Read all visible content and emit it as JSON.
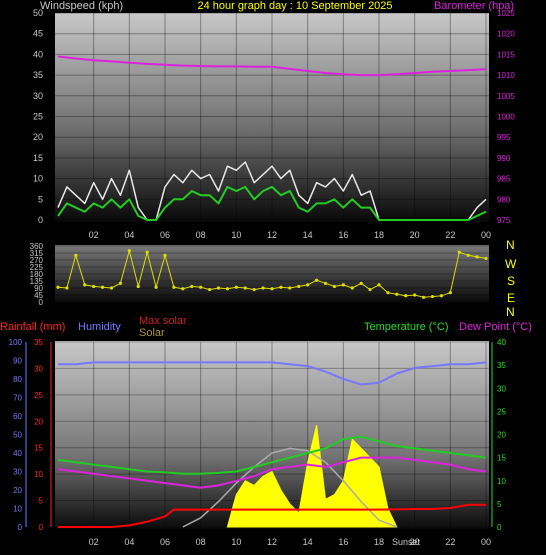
{
  "header": {
    "windspeed_label": "Windspeed (kph)",
    "title": "24 hour graph day : 10 September 2025",
    "barometer_label": "Barometer (hpa)"
  },
  "legend": {
    "rainfall": "Rainfall (mm)",
    "humidity": "Humidity",
    "max_solar": "Max solar",
    "solar": "Solar",
    "temperature": "Temperature (°C)",
    "dew_point": "Dew Point (°C)"
  },
  "annotations": {
    "sunset": "Sunset"
  },
  "colors": {
    "wind_gust": "#e8e8e8",
    "wind_avg": "#22cc22",
    "barometer": "#dd22dd",
    "direction": "#dddd00",
    "rain": "#ff0000",
    "humidity": "#7777ff",
    "temperature": "#22cc22",
    "dew_point": "#dd22dd",
    "solar": "#ffff00",
    "max_solar": "#aaaaaa"
  },
  "chart_data": [
    {
      "type": "line",
      "title": "24 hour graph day : 10 September 2025",
      "xlabel": "",
      "x_ticks": [
        "02",
        "04",
        "06",
        "08",
        "10",
        "12",
        "14",
        "16",
        "18",
        "20",
        "22",
        "00"
      ],
      "left_axis": {
        "label": "Windspeed (kph)",
        "ylim": [
          0,
          50
        ],
        "ticks": [
          0,
          5,
          10,
          15,
          20,
          25,
          30,
          35,
          40,
          45,
          50
        ]
      },
      "right_axis": {
        "label": "Barometer (hpa)",
        "ylim": [
          975,
          1025
        ],
        "ticks": [
          975,
          980,
          985,
          990,
          995,
          1000,
          1005,
          1010,
          1015,
          1020,
          1025
        ]
      },
      "series": [
        {
          "name": "Barometer (hpa)",
          "axis": "right",
          "x": [
            0,
            1,
            2,
            3,
            4,
            5,
            6,
            7,
            8,
            9,
            10,
            11,
            12,
            13,
            14,
            15,
            16,
            17,
            18,
            19,
            20,
            21,
            22,
            23,
            24
          ],
          "values": [
            1014.5,
            1014.0,
            1013.6,
            1013.3,
            1013.0,
            1012.7,
            1012.5,
            1012.3,
            1012.2,
            1012.1,
            1012.1,
            1012.0,
            1012.0,
            1011.5,
            1011.0,
            1010.5,
            1010.2,
            1010.0,
            1010.0,
            1010.2,
            1010.5,
            1010.8,
            1011.0,
            1011.2,
            1011.4
          ]
        },
        {
          "name": "Windspeed (kph)",
          "axis": "left",
          "x": [
            0,
            0.5,
            1,
            1.5,
            2,
            2.5,
            3,
            3.5,
            4,
            4.5,
            5,
            5.5,
            6,
            6.5,
            7,
            7.5,
            8,
            8.5,
            9,
            9.5,
            10,
            10.5,
            11,
            11.5,
            12,
            12.5,
            13,
            13.5,
            14,
            14.5,
            15,
            15.5,
            16,
            16.5,
            17,
            17.5,
            18,
            18.5,
            19,
            20,
            21,
            22,
            23,
            23.5,
            24
          ],
          "values": [
            3,
            8,
            6,
            4,
            9,
            5,
            10,
            6,
            12,
            3,
            0,
            0,
            8,
            11,
            9,
            12,
            10,
            11,
            7,
            13,
            12,
            14,
            9,
            11,
            13,
            10,
            12,
            6,
            4,
            9,
            8,
            10,
            7,
            11,
            6,
            7,
            0,
            0,
            0,
            0,
            0,
            0,
            0,
            3,
            5
          ]
        },
        {
          "name": "Average windspeed",
          "axis": "left",
          "x": [
            0,
            0.5,
            1,
            1.5,
            2,
            2.5,
            3,
            3.5,
            4,
            4.5,
            5,
            5.5,
            6,
            6.5,
            7,
            7.5,
            8,
            8.5,
            9,
            9.5,
            10,
            10.5,
            11,
            11.5,
            12,
            12.5,
            13,
            13.5,
            14,
            14.5,
            15,
            15.5,
            16,
            16.5,
            17,
            17.5,
            18,
            18.5,
            19,
            20,
            21,
            22,
            23,
            23.5,
            24
          ],
          "values": [
            1,
            4,
            3,
            2,
            4,
            3,
            5,
            3,
            5,
            1,
            0,
            0,
            3,
            5,
            5,
            7,
            6,
            6,
            4,
            8,
            7,
            8,
            5,
            7,
            8,
            6,
            7,
            3,
            2,
            4,
            4,
            5,
            3,
            5,
            3,
            3,
            0,
            0,
            0,
            0,
            0,
            0,
            0,
            1,
            2
          ]
        }
      ]
    },
    {
      "type": "scatter",
      "title": "",
      "x_ticks": [],
      "left_axis": {
        "ylim": [
          0,
          360
        ],
        "ticks": [
          0,
          45,
          90,
          135,
          180,
          225,
          270,
          315,
          360
        ]
      },
      "right_axis_labels": [
        "N",
        "W",
        "S",
        "E",
        "N"
      ],
      "series": [
        {
          "name": "",
          "x": [
            0,
            0.5,
            1,
            1.5,
            2,
            2.5,
            3,
            3.5,
            4,
            4.5,
            5,
            5.5,
            6,
            6.5,
            7,
            7.5,
            8,
            8.5,
            9,
            9.5,
            10,
            10.5,
            11,
            11.5,
            12,
            12.5,
            13,
            13.5,
            14,
            14.5,
            15,
            15.5,
            16,
            16.5,
            17,
            17.5,
            18,
            18.5,
            19,
            19.5,
            20,
            20.5,
            21,
            21.5,
            22,
            22.5,
            23,
            23.5,
            24
          ],
          "values": [
            95,
            90,
            300,
            110,
            100,
            95,
            90,
            120,
            330,
            100,
            320,
            95,
            300,
            95,
            85,
            100,
            95,
            80,
            90,
            85,
            95,
            90,
            80,
            90,
            85,
            95,
            90,
            100,
            110,
            140,
            120,
            100,
            110,
            90,
            120,
            80,
            110,
            60,
            50,
            40,
            45,
            30,
            35,
            40,
            60,
            320,
            300,
            290,
            280
          ]
        }
      ]
    },
    {
      "type": "line",
      "title": "",
      "x_ticks": [
        "02",
        "04",
        "06",
        "08",
        "10",
        "12",
        "14",
        "16",
        "18",
        "20",
        "22",
        "00"
      ],
      "axes": {
        "humidity": {
          "ylim": [
            0,
            100
          ],
          "ticks": [
            0,
            10,
            20,
            30,
            40,
            50,
            60,
            70,
            80,
            90,
            100
          ]
        },
        "rainfall": {
          "ylim": [
            0,
            35
          ],
          "ticks": [
            0,
            5,
            10,
            15,
            20,
            25,
            30,
            35
          ]
        },
        "temperature": {
          "ylim": [
            0,
            40
          ],
          "ticks": [
            0,
            5,
            10,
            15,
            20,
            25,
            30,
            35,
            40
          ]
        }
      },
      "series": [
        {
          "name": "Humidity",
          "axis": "humidity",
          "x": [
            0,
            1,
            2,
            3,
            4,
            5,
            6,
            7,
            8,
            9,
            10,
            11,
            12,
            13,
            14,
            15,
            16,
            17,
            18,
            19,
            20,
            21,
            22,
            23,
            24
          ],
          "values": [
            88,
            88,
            89,
            89,
            89,
            89,
            89,
            89,
            89,
            89,
            89,
            89,
            89,
            88,
            87,
            84,
            80,
            77,
            78,
            83,
            86,
            87,
            88,
            88,
            89
          ]
        },
        {
          "name": "Rainfall (mm)",
          "axis": "rainfall",
          "x": [
            0,
            3,
            4,
            5,
            6,
            6.5,
            8,
            10,
            12,
            14,
            16,
            18,
            20,
            21,
            22,
            23,
            24
          ],
          "values": [
            0,
            0,
            0.3,
            1,
            2,
            3.3,
            3.3,
            3.3,
            3.3,
            3.3,
            3.3,
            3.3,
            3.4,
            3.4,
            3.6,
            4.2,
            4.2
          ]
        },
        {
          "name": "Temperature (°C)",
          "axis": "temperature",
          "x": [
            0,
            1,
            2,
            3,
            4,
            5,
            6,
            7,
            8,
            9,
            10,
            11,
            12,
            13,
            14,
            15,
            16,
            17,
            18,
            19,
            20,
            21,
            22,
            23,
            24
          ],
          "values": [
            14.5,
            14,
            13.5,
            13,
            12.5,
            12,
            11.8,
            11.5,
            11.5,
            11.7,
            12,
            13,
            14,
            15,
            16,
            17,
            19,
            19.5,
            18.5,
            17.5,
            17,
            16.5,
            16,
            15.5,
            15
          ]
        },
        {
          "name": "Dew Point (°C)",
          "axis": "temperature",
          "x": [
            0,
            1,
            2,
            3,
            4,
            5,
            6,
            7,
            8,
            9,
            10,
            11,
            12,
            13,
            14,
            15,
            16,
            17,
            18,
            19,
            20,
            21,
            22,
            23,
            24
          ],
          "values": [
            12.5,
            12,
            11.5,
            11,
            10.5,
            10,
            9.5,
            9,
            8.5,
            9,
            10,
            11,
            12.5,
            13,
            13.5,
            13,
            14,
            15,
            15,
            15,
            14.5,
            14,
            13.5,
            12.5,
            12
          ]
        },
        {
          "name": "Max solar",
          "axis": "temperature",
          "x": [
            7,
            8,
            9,
            10,
            11,
            12,
            13,
            14,
            15,
            16,
            17,
            18,
            19
          ],
          "values": [
            0,
            2,
            5.5,
            9.5,
            13,
            16,
            17,
            16.5,
            14,
            10,
            5.5,
            1.5,
            0
          ]
        },
        {
          "name": "Solar",
          "axis": "temperature",
          "x": [
            9.5,
            10,
            10.5,
            11,
            11.5,
            12,
            12.5,
            13,
            13.5,
            14,
            14.5,
            15,
            15.5,
            16,
            16.5,
            17,
            17.5,
            18,
            18.5,
            19
          ],
          "values": [
            0,
            7,
            10,
            9,
            11,
            12,
            8,
            5,
            3,
            14,
            22,
            6,
            7,
            10,
            19,
            17,
            15,
            13,
            4,
            0
          ]
        }
      ],
      "annotations": [
        "Sunset"
      ]
    }
  ]
}
